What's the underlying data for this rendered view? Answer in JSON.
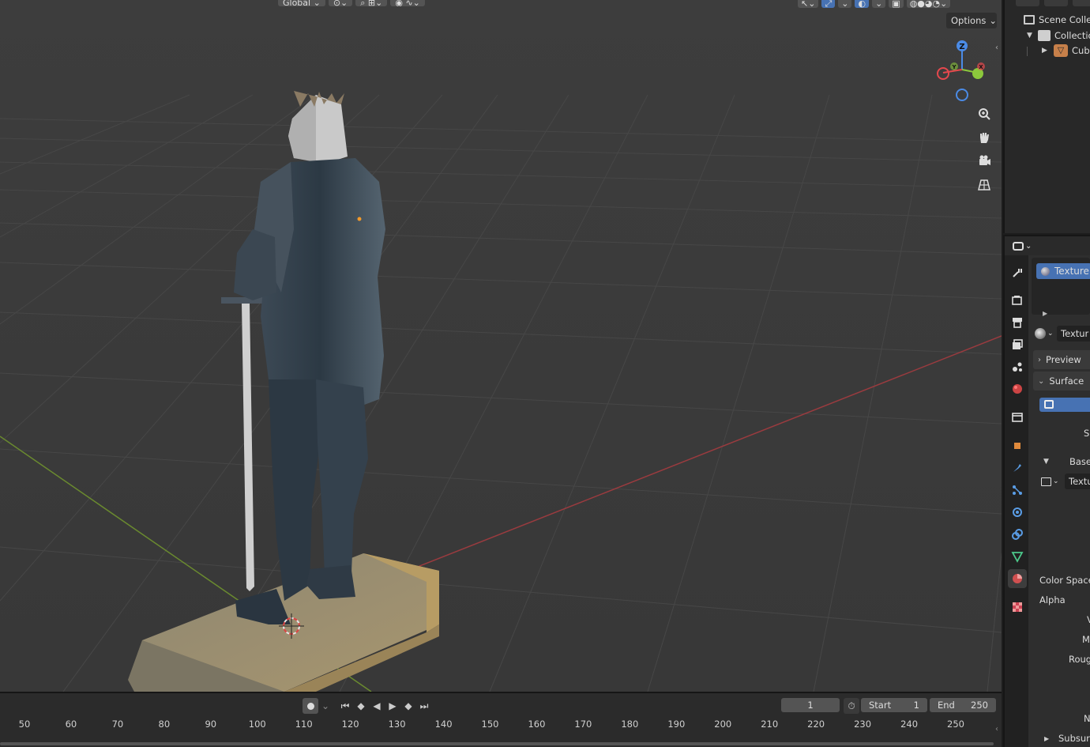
{
  "viewport_header": {
    "orientation_label": "Global",
    "options_label": "Options"
  },
  "gizmo": {
    "z": "Z",
    "y": "Y",
    "x": "X"
  },
  "timeline": {
    "current_frame": "1",
    "start_label": "Start",
    "start_value": "1",
    "end_label": "End",
    "end_value": "250",
    "ruler_ticks": [
      "50",
      "60",
      "70",
      "80",
      "90",
      "100",
      "110",
      "120",
      "130",
      "140",
      "150",
      "160",
      "170",
      "180",
      "190",
      "200",
      "210",
      "220",
      "230",
      "240",
      "250"
    ]
  },
  "outliner": {
    "items": [
      {
        "label": "Scene Collec"
      },
      {
        "label": "Collectio"
      },
      {
        "label": "Cube"
      }
    ]
  },
  "properties": {
    "material_slot": "Texture",
    "material_name": "Textur",
    "preview_label": "Preview",
    "surface_label": "Surface",
    "surface_s_fragment": "S",
    "base_label": "Base",
    "texture_label": "Textu",
    "color_space_label": "Color Space",
    "alpha_label": "Alpha",
    "v_fragment": "V",
    "m_fragment": "M",
    "roughness_fragment": "Roug",
    "n_fragment": "N",
    "subsurface_label": "Subsurf"
  },
  "icons": [
    "tool-icon",
    "render-icon",
    "output-icon",
    "view-layer-icon",
    "scene-icon",
    "world-icon",
    "collection-icon",
    "object-icon",
    "modifier-icon",
    "particles-icon",
    "physics-icon",
    "constraints-icon",
    "data-icon",
    "material-icon",
    "texture-icon"
  ],
  "colors": {
    "accent": "#4772b3",
    "x_axis": "#e5484d",
    "y_axis": "#8cc83c",
    "z_axis": "#4b8be6"
  }
}
